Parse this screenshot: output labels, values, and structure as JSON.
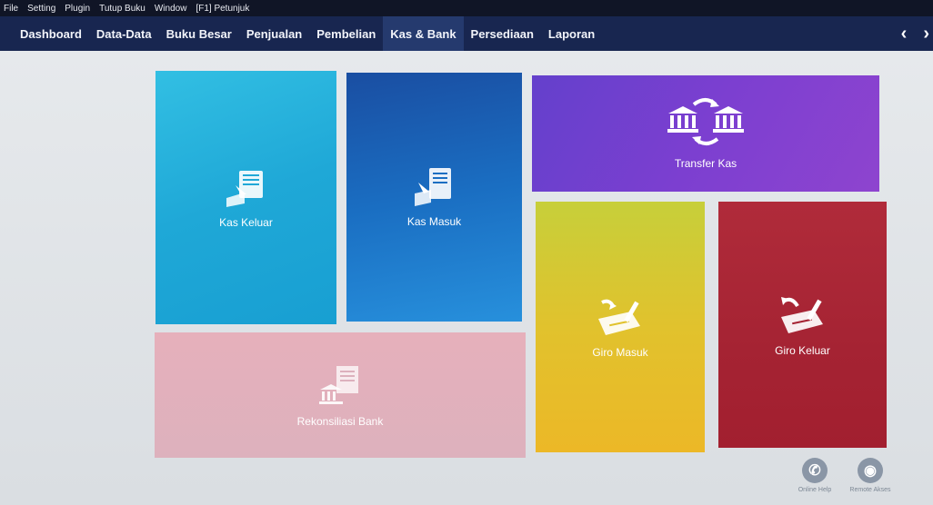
{
  "menu": [
    "File",
    "Setting",
    "Plugin",
    "Tutup Buku",
    "Window",
    "[F1] Petunjuk"
  ],
  "nav": {
    "items": [
      "Dashboard",
      "Data-Data",
      "Buku Besar",
      "Penjualan",
      "Pembelian",
      "Kas & Bank",
      "Persediaan",
      "Laporan"
    ],
    "active_index": 5,
    "prev_label": "‹",
    "next_label": "›"
  },
  "tiles": {
    "kas_keluar": {
      "label": "Kas Keluar",
      "icon": "document-out-icon"
    },
    "kas_masuk": {
      "label": "Kas Masuk",
      "icon": "document-in-icon"
    },
    "transfer_kas": {
      "label": "Transfer Kas",
      "icon": "bank-transfer-icon"
    },
    "rekonsiliasi_bank": {
      "label": "Rekonsiliasi Bank",
      "icon": "bank-reconcile-icon"
    },
    "giro_masuk": {
      "label": "Giro Masuk",
      "icon": "cheque-in-icon"
    },
    "giro_keluar": {
      "label": "Giro Keluar",
      "icon": "cheque-out-icon"
    }
  },
  "footer": {
    "online_help": "Online Help",
    "remote_akses": "Remote Akses"
  },
  "colors": {
    "kas_keluar": "#1fa8d7",
    "kas_masuk": "#1a6ec2",
    "transfer_kas": "#7c3fd0",
    "rekonsiliasi_bank": "#ddb1bd",
    "giro_masuk": "#e1c22d",
    "giro_keluar": "#a52333",
    "navbar": "#182650"
  }
}
